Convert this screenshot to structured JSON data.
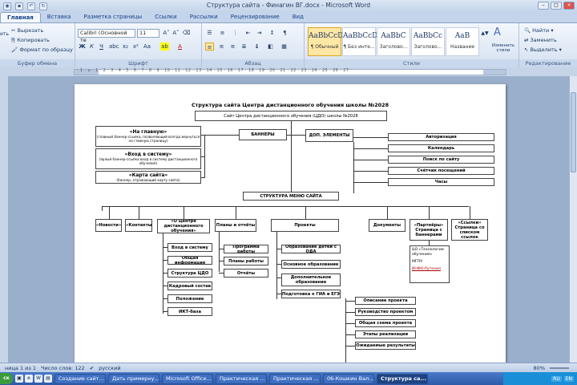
{
  "window": {
    "title": "Структура сайта - Финагин ВГ.docx - Microsoft Word"
  },
  "tabs": [
    "Главная",
    "Вставка",
    "Разметка страницы",
    "Ссылки",
    "Рассылки",
    "Рецензирование",
    "Вид"
  ],
  "ribbon": {
    "clipboard": {
      "cut": "Вырезать",
      "copy": "Копировать",
      "format": "Формат по образцу",
      "paste": "ить",
      "label": "Буфер обмена"
    },
    "font": {
      "family": "Calibri (Основной те",
      "size": "11",
      "label": "Шрифт"
    },
    "paragraph": {
      "label": "Абзац"
    },
    "styles": {
      "label": "Стили",
      "items": [
        {
          "sample": "AaBbCcDc",
          "name": "¶ Обычный"
        },
        {
          "sample": "AaBbCcDc",
          "name": "¶ Без инте..."
        },
        {
          "sample": "AaBbC",
          "name": "Заголово..."
        },
        {
          "sample": "AaBbCc",
          "name": "Заголово..."
        },
        {
          "sample": "AaB",
          "name": "Название"
        }
      ],
      "change": "Изменить стили"
    },
    "editing": {
      "find": "Найти",
      "replace": "Заменить",
      "select": "Выделить",
      "label": "Редактирование"
    }
  },
  "ruler": {
    "text": "· 1 · ⌂ · 1 · 2 · 3 · 4 · 5 · 6 · 7 · 8 · 9 · 10 · 11 · 12 · 13 · 14 · 15 · 16 · 17 · 18 · 19 · 20 · 21 · 22 · 23 · 24 · 25 · 26 · 27"
  },
  "doc": {
    "title": "Структура сайта Центра дистанционного обучения школы №2028",
    "site": "Сайт Центра дистанционного обучения (ЦДО) школы №2028",
    "banners": "БАННЕРЫ",
    "extras": "ДОП. ЭЛЕМЕНТЫ",
    "left_boxes": [
      {
        "t": "«На главную»",
        "s": "(главный баннер-ссылка, позволяющий всегда вернуться на главную страницу)"
      },
      {
        "t": "«Вход в систему»",
        "s": "(ярлый баннер-ссылка вход в систему дистанционного обучения)"
      },
      {
        "t": "«Карта сайта»",
        "s": "(баннер, отражающий карту сайта)"
      }
    ],
    "right_boxes": [
      "Авторизация",
      "Календарь",
      "Поиск по сайту",
      "Счётчик посещений",
      "Часы"
    ],
    "menu": "СТРУКТУРА МЕНЮ САЙТА",
    "menu_items": [
      "«Новости»",
      "«Контакты»",
      "«О Центре дистанционного обучения»",
      "Планы и отчёты",
      "Проекты",
      "Документы",
      "«Партнёры» Страница с баннерами",
      "«Ссылки» Страница со списком ссылок"
    ],
    "center_sub": [
      "Вход в систему",
      "Общая информация",
      "Структура ЦДО",
      "Кадровый состав",
      "Положение",
      "ИКТ-база"
    ],
    "plans_sub": [
      "Программа работы",
      "Планы работы",
      "Отчёты"
    ],
    "projects_sub": [
      "Образование детей с ОДА",
      "Основное образование",
      "Дополнительное образование",
      "Подготовка к ГИА и ЕГЭ"
    ],
    "project_steps": [
      "Описание проекта",
      "Руководство проектом",
      "Общая схема проекта",
      "Этапы реализации",
      "Ожидаемые результаты"
    ],
    "partners_list": [
      "ЦО «Технологии обучения»",
      "МГПУ",
      "ИНФО-Рутения"
    ]
  },
  "status": {
    "page": "ница 1 из 1",
    "words": "Число слов: 122",
    "lang": "русский",
    "zoom": "80%"
  },
  "taskbar": {
    "start": "ск",
    "items": [
      "Создание сайт...",
      "Дать примерну...",
      "Microsoft Office...",
      "Практическая ...",
      "Практическая ...",
      "06-Кошкин Вал...",
      "Структура са..."
    ],
    "tray": [
      "RU",
      "EN"
    ]
  }
}
